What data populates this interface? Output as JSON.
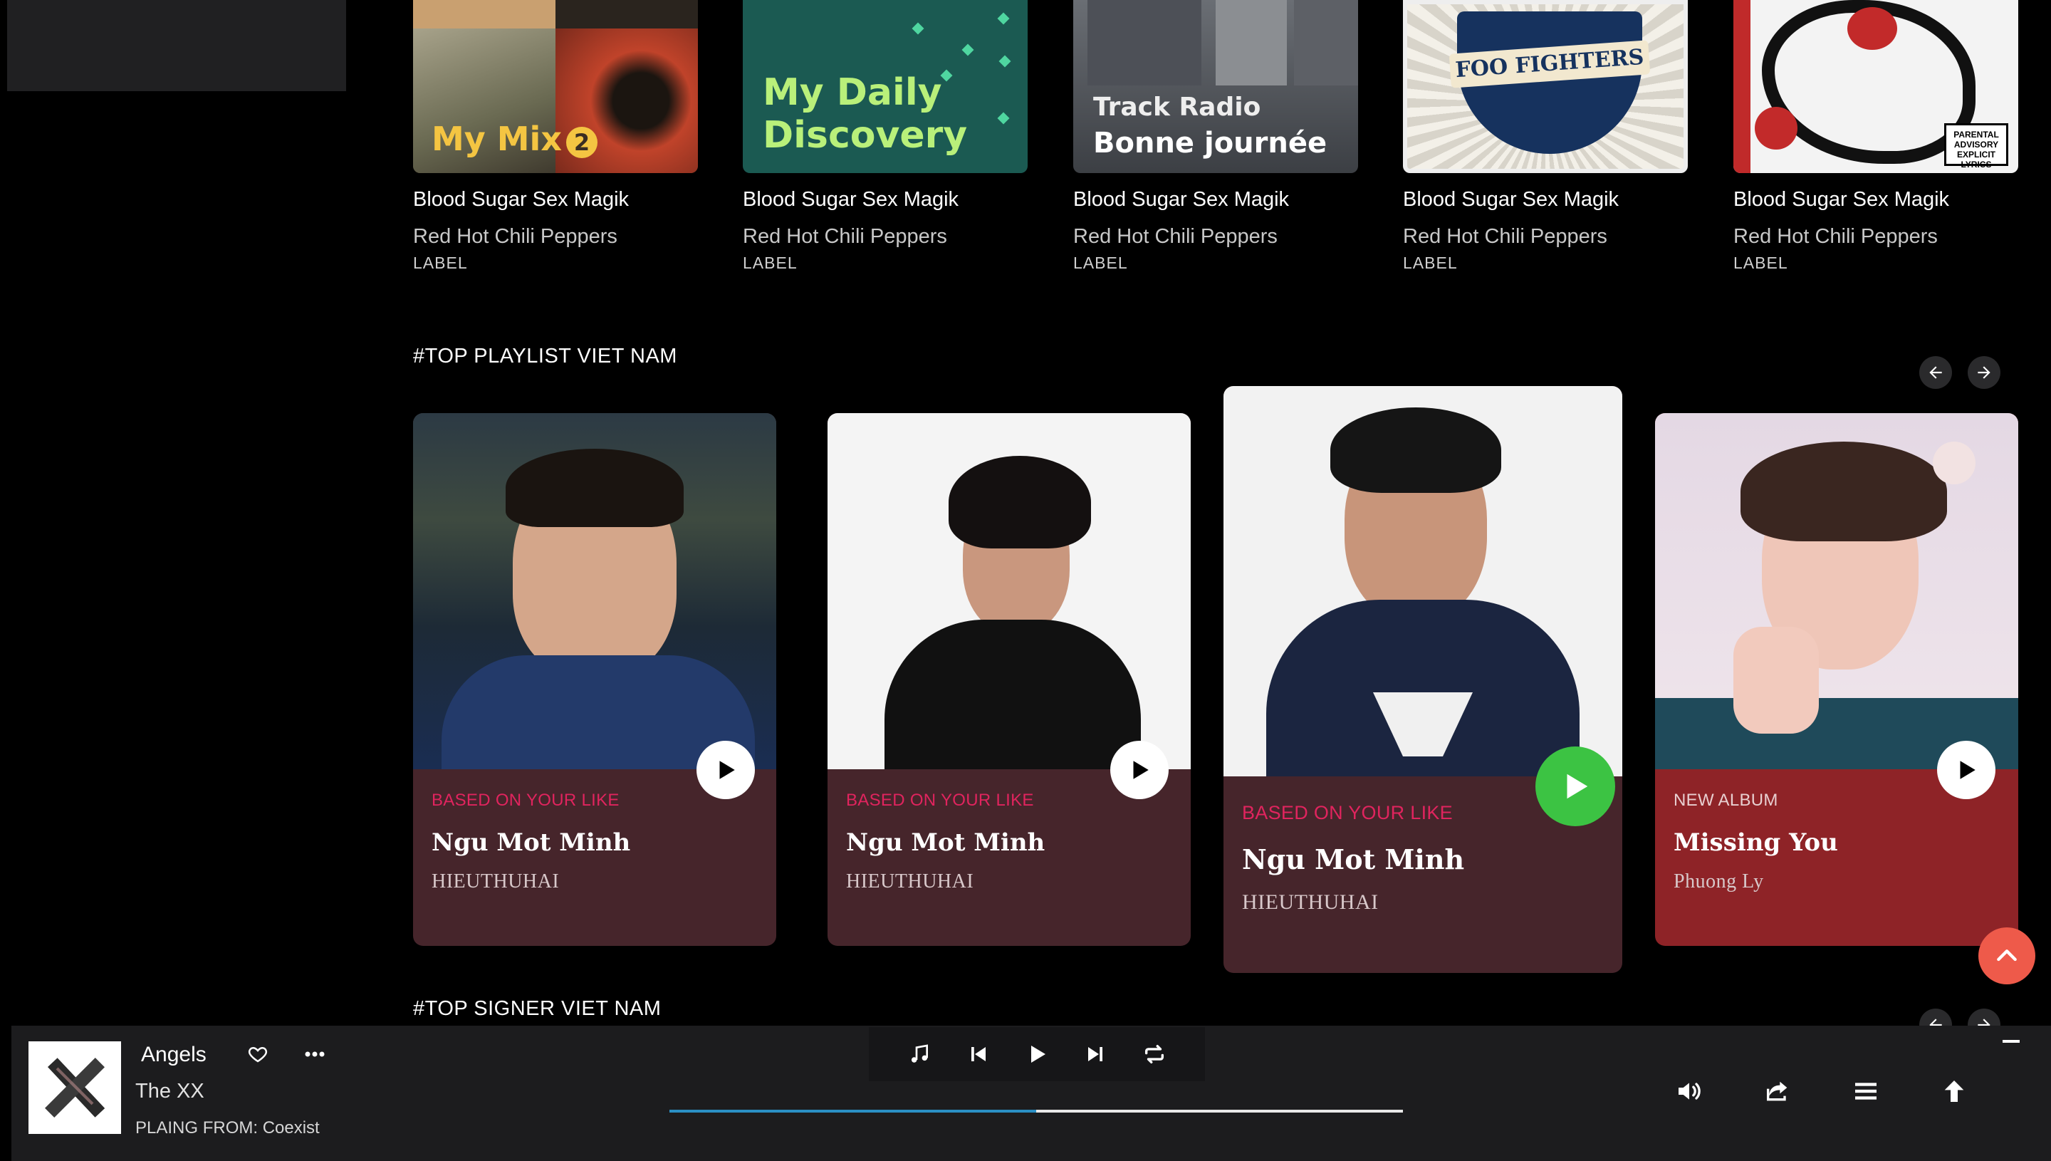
{
  "albums": [
    {
      "cover_text": "My Mix",
      "cover_badge": "2",
      "title": "Blood Sugar Sex Magik",
      "artist": "Red Hot Chili Peppers",
      "label": "LABEL"
    },
    {
      "cover_text_line1": "My Daily",
      "cover_text_line2": "Discovery",
      "title": "Blood Sugar Sex Magik",
      "artist": "Red Hot Chili Peppers",
      "label": "LABEL"
    },
    {
      "cover_text_line1": "Track Radio",
      "cover_text_line2": "Bonne journée",
      "title": "Blood Sugar Sex Magik",
      "artist": "Red Hot Chili Peppers",
      "label": "LABEL"
    },
    {
      "cover_text": "FOO FIGHTERS",
      "title": "Blood Sugar Sex Magik",
      "artist": "Red Hot Chili Peppers",
      "label": "LABEL"
    },
    {
      "cover_text": "PARENTAL ADVISORY EXPLICIT LYRICS",
      "title": "Blood Sugar Sex Magik",
      "artist": "Red Hot Chili Peppers",
      "label": "LABEL"
    }
  ],
  "top_playlist": {
    "title": "#TOP PLAYLIST VIET NAM",
    "prev_icon": "arrow-left-icon",
    "next_icon": "arrow-right-icon",
    "cards": [
      {
        "tag": "BASED ON YOUR LIKE",
        "name": "Ngu Mot Minh",
        "artist": "HIEUTHUHAI",
        "active": false
      },
      {
        "tag": "BASED ON YOUR LIKE",
        "name": "Ngu Mot Minh",
        "artist": "HIEUTHUHAI",
        "active": false
      },
      {
        "tag": "BASED ON YOUR LIKE",
        "name": "Ngu Mot Minh",
        "artist": "HIEUTHUHAI",
        "active": true
      },
      {
        "tag": "NEW ALBUM",
        "name": "Missing You",
        "artist": "Phuong Ly",
        "active": false
      }
    ]
  },
  "top_singer": {
    "title": "#TOP SIGNER VIET NAM"
  },
  "player": {
    "song_title": "Angels",
    "artist": "The XX",
    "playing_from": "PLAING FROM: Coexist",
    "progress": 0.5,
    "controls": [
      "music-note-icon",
      "skip-previous-icon",
      "play-icon",
      "skip-next-icon",
      "repeat-icon"
    ],
    "right_controls": [
      "volume-icon",
      "share-icon",
      "queue-icon",
      "expand-up-icon"
    ]
  },
  "colors": {
    "tag_pink": "#e0245e",
    "card_bg": "#46252b",
    "card_bg_new": "#8e2327",
    "play_active": "#3cc343",
    "scroll_top": "#ee5a4a",
    "progress_fill": "#2a8fc4"
  }
}
